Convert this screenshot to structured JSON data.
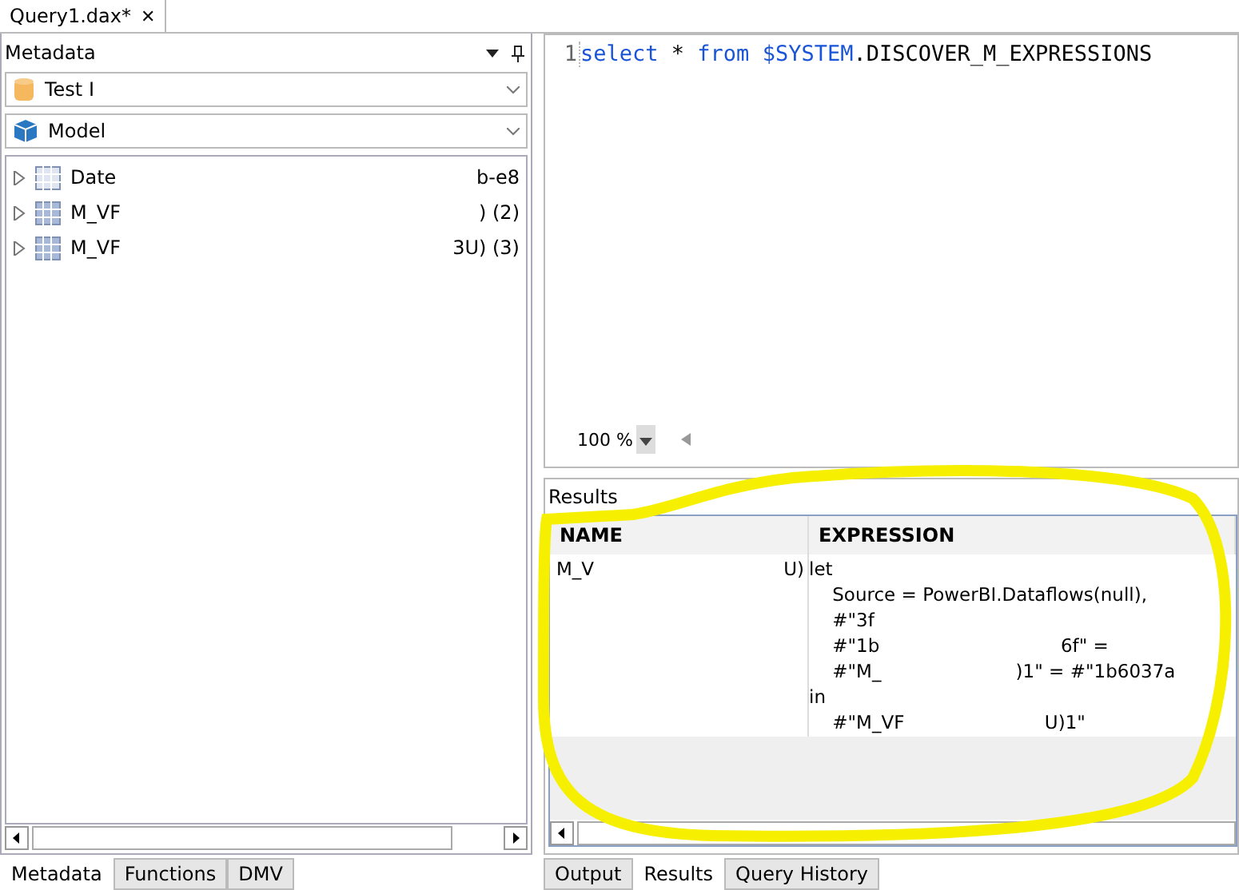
{
  "document_tab": {
    "label": "Query1.dax*",
    "close": "✕"
  },
  "metadata": {
    "title": "Metadata",
    "connection": "Test I",
    "model": "Model",
    "tree": [
      {
        "parts": [
          "Date",
          "b-e8"
        ],
        "kind": "template",
        "expanded": false
      },
      {
        "parts": [
          "M_VF",
          ") (2)"
        ],
        "kind": "table",
        "expanded": false
      },
      {
        "parts": [
          "M_VF",
          "3U) (3)"
        ],
        "kind": "table",
        "expanded": false
      }
    ],
    "tabs": [
      {
        "label": "Metadata",
        "selected": true
      },
      {
        "label": "Functions",
        "selected": false
      },
      {
        "label": "DMV",
        "selected": false
      }
    ]
  },
  "editor": {
    "line_number": "1",
    "tokens": [
      {
        "text": "select",
        "kind": "keyword"
      },
      {
        "text": " * ",
        "kind": "plain"
      },
      {
        "text": "from",
        "kind": "keyword"
      },
      {
        "text": " $SYSTEM",
        "kind": "keyword"
      },
      {
        "text": ".DISCOVER_M_EXPRESSIONS",
        "kind": "plain"
      }
    ],
    "zoom": "100 %"
  },
  "results": {
    "title": "Results",
    "columns": [
      "NAME",
      "EXPRESSION"
    ],
    "row": {
      "name": [
        "M_V",
        "U)"
      ],
      "expression": [
        "let",
        "    Source = PowerBI.Dataflows(null),",
        "    #\"3f",
        "    #\"1b                               6f\" =",
        "    #\"M_                       )1\" = #\"1b6037a",
        "in",
        "    #\"M_VF                        U)1\""
      ]
    },
    "tabs": [
      {
        "label": "Output",
        "selected": false
      },
      {
        "label": "Results",
        "selected": true
      },
      {
        "label": "Query History",
        "selected": false
      }
    ]
  }
}
